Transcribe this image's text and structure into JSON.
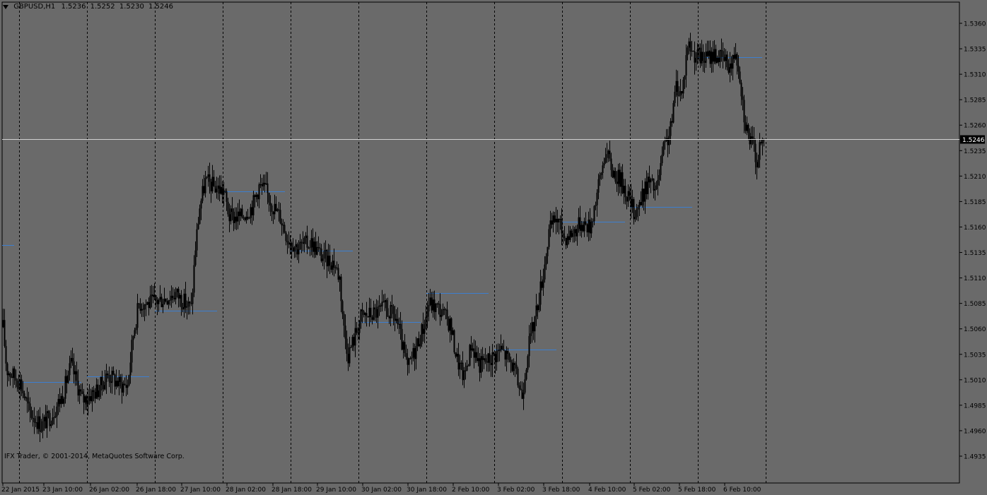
{
  "header": {
    "symbol": "GBPUSD,H1",
    "open": "1.5236",
    "high": "1.5252",
    "low": "1.5230",
    "close": "1.5246"
  },
  "footer": {
    "copyright": "IFX Trader, © 2001-2014, MetaQuotes Software Corp."
  },
  "colors": {
    "background": "#6a6a6a",
    "candle": "#000000",
    "pivot_line": "#3d7fcf",
    "current_price_line": "#d0d0d0",
    "price_label_bg": "#000000",
    "price_label_text": "#ffffff"
  },
  "chart_data": {
    "type": "candlestick",
    "timeframe": "H1",
    "x_tick_labels": [
      "22 Jan 2015",
      "23 Jan 10:00",
      "26 Jan 02:00",
      "26 Jan 18:00",
      "27 Jan 10:00",
      "28 Jan 02:00",
      "28 Jan 18:00",
      "29 Jan 10:00",
      "30 Jan 02:00",
      "30 Jan 18:00",
      "2 Feb 10:00",
      "3 Feb 02:00",
      "3 Feb 18:00",
      "4 Feb 10:00",
      "5 Feb 02:00",
      "5 Feb 18:00",
      "6 Feb 10:00"
    ],
    "y_ticks": [
      "1.5360",
      "1.5335",
      "1.5310",
      "1.5285",
      "1.5260",
      "1.5235",
      "1.5210",
      "1.5185",
      "1.5160",
      "1.5135",
      "1.5110",
      "1.5085",
      "1.5060",
      "1.5035",
      "1.5010",
      "1.4985",
      "1.4960",
      "1.4935"
    ],
    "ylim": [
      1.4935,
      1.536
    ],
    "current_price": "1.5246",
    "day_separators": true,
    "daily_levels": [
      {
        "label": "22 Jan",
        "value": 1.5142
      },
      {
        "label": "23 Jan",
        "value": 1.5008
      },
      {
        "label": "26 Jan",
        "value": 1.5013
      },
      {
        "label": "27 Jan",
        "value": 1.5078
      },
      {
        "label": "28 Jan",
        "value": 1.5195
      },
      {
        "label": "29 Jan",
        "value": 1.5137
      },
      {
        "label": "30 Jan",
        "value": 1.5067
      },
      {
        "label": "2 Feb",
        "value": 1.5095
      },
      {
        "label": "3 Feb",
        "value": 1.504
      },
      {
        "label": "4 Feb",
        "value": 1.5165
      },
      {
        "label": "5 Feb",
        "value": 1.518
      },
      {
        "label": "6 Feb",
        "value": 1.5327
      }
    ],
    "price_path": [
      [
        0,
        1.5095
      ],
      [
        9,
        1.502
      ],
      [
        28,
        1.5008
      ],
      [
        40,
        1.498
      ],
      [
        58,
        1.4965
      ],
      [
        72,
        1.4975
      ],
      [
        88,
        1.4995
      ],
      [
        100,
        1.5025
      ],
      [
        116,
        1.499
      ],
      [
        138,
        1.5
      ],
      [
        152,
        1.5015
      ],
      [
        170,
        1.5005
      ],
      [
        180,
        1.5005
      ],
      [
        188,
        1.5055
      ],
      [
        196,
        1.5085
      ],
      [
        212,
        1.5085
      ],
      [
        232,
        1.509
      ],
      [
        248,
        1.5095
      ],
      [
        262,
        1.5085
      ],
      [
        270,
        1.508
      ],
      [
        276,
        1.514
      ],
      [
        282,
        1.518
      ],
      [
        290,
        1.5205
      ],
      [
        302,
        1.52
      ],
      [
        316,
        1.5195
      ],
      [
        324,
        1.517
      ],
      [
        340,
        1.517
      ],
      [
        356,
        1.518
      ],
      [
        366,
        1.52
      ],
      [
        376,
        1.5195
      ],
      [
        386,
        1.518
      ],
      [
        396,
        1.517
      ],
      [
        406,
        1.515
      ],
      [
        420,
        1.514
      ],
      [
        440,
        1.5145
      ],
      [
        456,
        1.513
      ],
      [
        472,
        1.5125
      ],
      [
        480,
        1.511
      ],
      [
        486,
        1.506
      ],
      [
        492,
        1.5035
      ],
      [
        500,
        1.505
      ],
      [
        510,
        1.5072
      ],
      [
        528,
        1.5075
      ],
      [
        544,
        1.508
      ],
      [
        560,
        1.507
      ],
      [
        568,
        1.5045
      ],
      [
        576,
        1.502
      ],
      [
        584,
        1.5035
      ],
      [
        592,
        1.505
      ],
      [
        600,
        1.5065
      ],
      [
        606,
        1.5085
      ],
      [
        620,
        1.508
      ],
      [
        636,
        1.5065
      ],
      [
        646,
        1.503
      ],
      [
        656,
        1.5012
      ],
      [
        666,
        1.5045
      ],
      [
        678,
        1.5025
      ],
      [
        692,
        1.503
      ],
      [
        708,
        1.504
      ],
      [
        724,
        1.5025
      ],
      [
        738,
        1.4995
      ],
      [
        746,
        1.504
      ],
      [
        756,
        1.507
      ],
      [
        768,
        1.5115
      ],
      [
        776,
        1.5155
      ],
      [
        786,
        1.517
      ],
      [
        798,
        1.515
      ],
      [
        810,
        1.5155
      ],
      [
        822,
        1.5165
      ],
      [
        834,
        1.516
      ],
      [
        846,
        1.52
      ],
      [
        856,
        1.5235
      ],
      [
        866,
        1.5215
      ],
      [
        878,
        1.5205
      ],
      [
        888,
        1.519
      ],
      [
        896,
        1.5175
      ],
      [
        906,
        1.5185
      ],
      [
        916,
        1.5205
      ],
      [
        928,
        1.5195
      ],
      [
        938,
        1.5235
      ],
      [
        948,
        1.5255
      ],
      [
        956,
        1.53
      ],
      [
        964,
        1.529
      ],
      [
        972,
        1.534
      ],
      [
        982,
        1.533
      ],
      [
        994,
        1.5325
      ],
      [
        1010,
        1.533
      ],
      [
        1022,
        1.5325
      ],
      [
        1034,
        1.5318
      ],
      [
        1040,
        1.5335
      ],
      [
        1046,
        1.531
      ],
      [
        1052,
        1.527
      ],
      [
        1058,
        1.525
      ],
      [
        1064,
        1.524
      ],
      [
        1070,
        1.5225
      ],
      [
        1076,
        1.524
      ],
      [
        1080,
        1.5246
      ]
    ]
  }
}
